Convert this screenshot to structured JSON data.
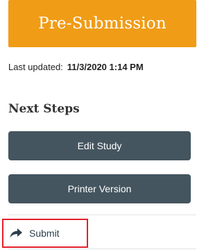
{
  "state": {
    "label": "Pre-Submission",
    "color": "#f09c17"
  },
  "last_updated": {
    "label": "Last updated:",
    "value": "11/3/2020 1:14 PM"
  },
  "next_steps": {
    "heading": "Next Steps",
    "buttons": [
      {
        "label": "Edit Study"
      },
      {
        "label": "Printer Version"
      }
    ]
  },
  "activities": [
    {
      "label": "Submit",
      "icon": "share-arrow-icon",
      "highlight_color": "#e3202b"
    }
  ],
  "colors": {
    "button_bg": "#44555f",
    "banner_text": "#ffffff"
  }
}
